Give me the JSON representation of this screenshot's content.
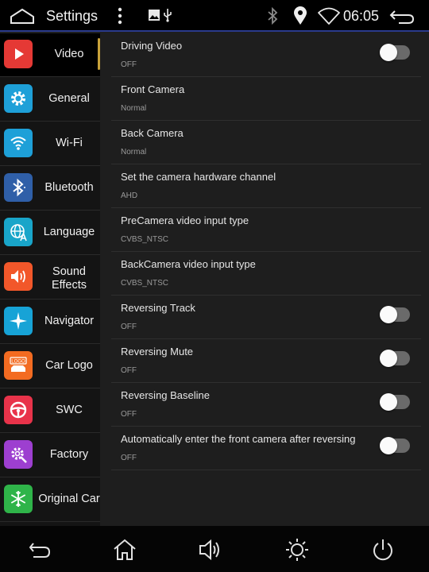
{
  "statusbar": {
    "title": "Settings",
    "time": "06:05",
    "icons": [
      "home-outline-icon",
      "overflow-menu-icon",
      "image-icon",
      "usb-icon",
      "bluetooth-icon",
      "location-icon",
      "wifi-icon",
      "back-arrow-icon"
    ]
  },
  "sidebar": {
    "active_index": 0,
    "accent": "#c9a23a",
    "items": [
      {
        "label": "Video",
        "icon": "play-icon",
        "color": "#e53935"
      },
      {
        "label": "General",
        "icon": "gear-icon",
        "color": "#1ea0d8"
      },
      {
        "label": "Wi-Fi",
        "icon": "wifi-icon",
        "color": "#1ea0d8"
      },
      {
        "label": "Bluetooth",
        "icon": "bluetooth-icon",
        "color": "#2f5fa8"
      },
      {
        "label": "Language",
        "icon": "globe-icon",
        "color": "#19a5c9"
      },
      {
        "label": "Sound Effects",
        "icon": "speaker-icon",
        "color": "#f2572a"
      },
      {
        "label": "Navigator",
        "icon": "compass-icon",
        "color": "#17a3d6"
      },
      {
        "label": "Car Logo",
        "icon": "car-logo-icon",
        "color": "#f36b21"
      },
      {
        "label": "SWC",
        "icon": "steering-wheel-icon",
        "color": "#e8334a"
      },
      {
        "label": "Factory",
        "icon": "factory-gear-icon",
        "color": "#9d3fd0"
      },
      {
        "label": "Original Car",
        "icon": "snowflake-icon",
        "color": "#2fb449"
      }
    ]
  },
  "settings": [
    {
      "title": "Driving Video",
      "value": "OFF",
      "toggle": true,
      "on": false
    },
    {
      "title": "Front Camera",
      "value": "Normal",
      "toggle": false
    },
    {
      "title": "Back Camera",
      "value": "Normal",
      "toggle": false
    },
    {
      "title": "Set the camera hardware channel",
      "value": "AHD",
      "toggle": false
    },
    {
      "title": "PreCamera video input type",
      "value": "CVBS_NTSC",
      "toggle": false
    },
    {
      "title": "BackCamera video input type",
      "value": "CVBS_NTSC",
      "toggle": false
    },
    {
      "title": "Reversing Track",
      "value": "OFF",
      "toggle": true,
      "on": false
    },
    {
      "title": "Reversing Mute",
      "value": "OFF",
      "toggle": true,
      "on": false
    },
    {
      "title": "Reversing Baseline",
      "value": "OFF",
      "toggle": true,
      "on": false
    },
    {
      "title": "Automatically enter the front camera after reversing",
      "value": "OFF",
      "toggle": true,
      "on": false
    }
  ],
  "navbar": {
    "buttons": [
      "back-icon",
      "home-icon",
      "volume-icon",
      "brightness-icon",
      "power-icon"
    ]
  }
}
